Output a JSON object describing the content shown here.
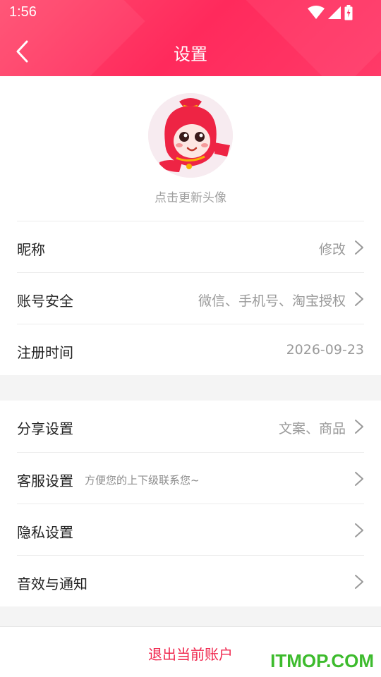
{
  "status_bar": {
    "time": "1:56"
  },
  "header": {
    "title": "设置"
  },
  "profile": {
    "avatar_caption": "点击更新头像"
  },
  "account_rows": [
    {
      "label": "昵称",
      "value": "修改"
    },
    {
      "label": "账号安全",
      "value": "微信、手机号、淘宝授权"
    },
    {
      "label": "注册时间",
      "value": "2026-09-23"
    }
  ],
  "settings_rows": [
    {
      "label": "分享设置",
      "value": "文案、商品"
    },
    {
      "label": "客服设置",
      "hint": "方便您的上下级联系您~"
    },
    {
      "label": "隐私设置"
    },
    {
      "label": "音效与通知"
    }
  ],
  "logout": {
    "label": "退出当前账户"
  },
  "watermark": {
    "text": "ITMOP.COM"
  },
  "colors": {
    "header": "#ff2d5e",
    "logout": "#f0284f",
    "watermark": "#3dbb2d"
  },
  "icons": [
    "wifi-icon",
    "signal-icon",
    "battery-icon",
    "back-arrow-icon",
    "chevron-right-icon"
  ]
}
